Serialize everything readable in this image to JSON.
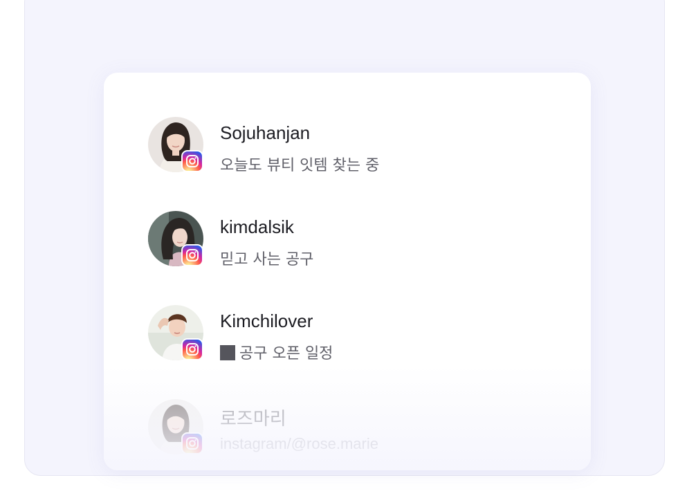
{
  "profiles": [
    {
      "name": "Sojuhanjan",
      "description": "오늘도 뷰티 잇템 찾는 중",
      "icon": "instagram-icon"
    },
    {
      "name": "kimdalsik",
      "description": "믿고 사는 공구",
      "icon": "instagram-icon"
    },
    {
      "name": "Kimchilover",
      "description": "공구 오픈 일정",
      "icon": "instagram-icon"
    },
    {
      "name": "로즈마리",
      "description": "instagram/@rose.marie",
      "icon": "instagram-icon"
    }
  ],
  "colors": {
    "panel_background": "#f4f4fd",
    "card_background": "#ffffff",
    "name_text": "#1c1c22",
    "description_text": "#5f5f68"
  }
}
